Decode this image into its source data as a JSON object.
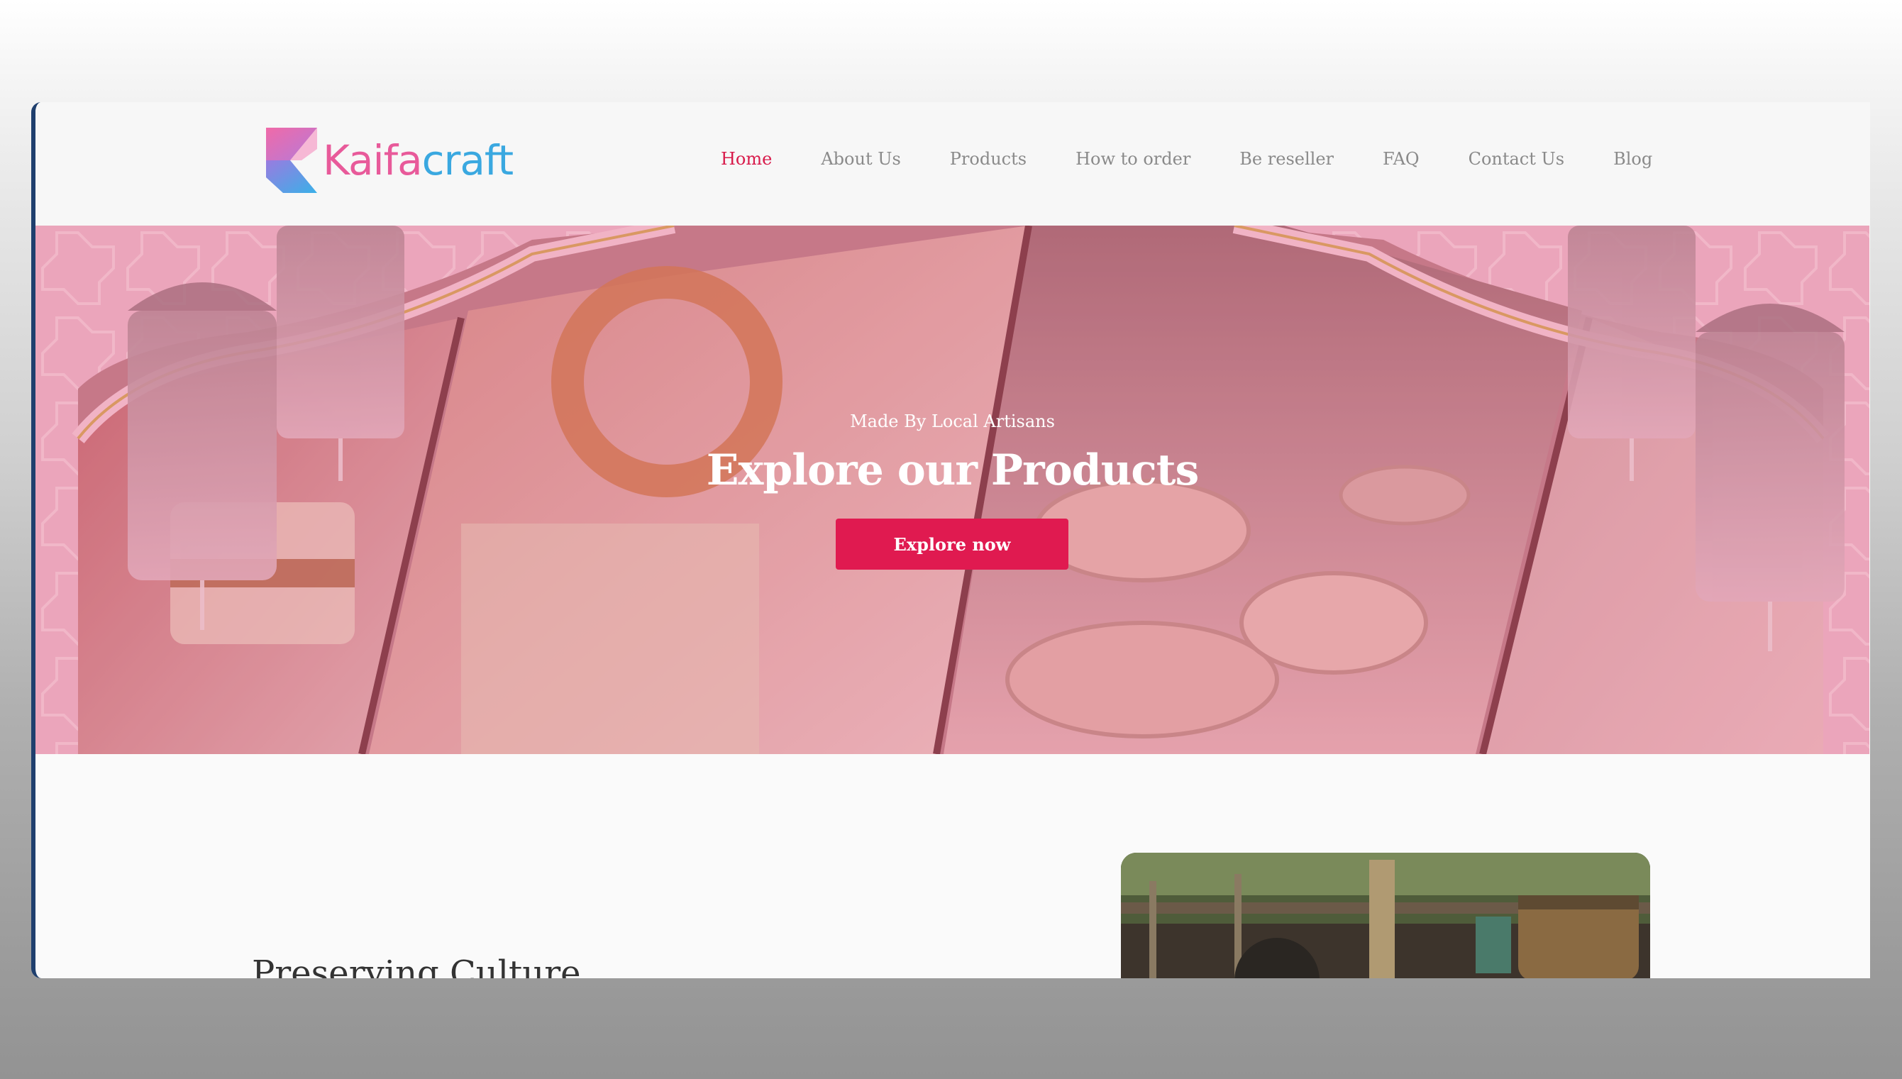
{
  "site": {
    "logo_text_k": "Kaifa",
    "logo_text_c": "craft"
  },
  "nav": {
    "items": [
      {
        "label": "Home",
        "active": true
      },
      {
        "label": "About Us",
        "active": false
      },
      {
        "label": "Products",
        "active": false
      },
      {
        "label": "How to order",
        "active": false
      },
      {
        "label": "Be reseller",
        "active": false
      },
      {
        "label": "FAQ",
        "active": false
      },
      {
        "label": "Contact Us",
        "active": false
      },
      {
        "label": "Blog",
        "active": false
      }
    ]
  },
  "hero": {
    "eyebrow": "Made By Local Artisans",
    "title": "Explore our Products",
    "button_label": "Explore now"
  },
  "section": {
    "title": "Preserving Culture"
  },
  "colors": {
    "accent": "#e01a50",
    "nav_active": "#d81b4b",
    "logo_pink": "#e85a9a",
    "logo_blue": "#3aa8e0",
    "hero_overlay": "#e6a3b7"
  }
}
